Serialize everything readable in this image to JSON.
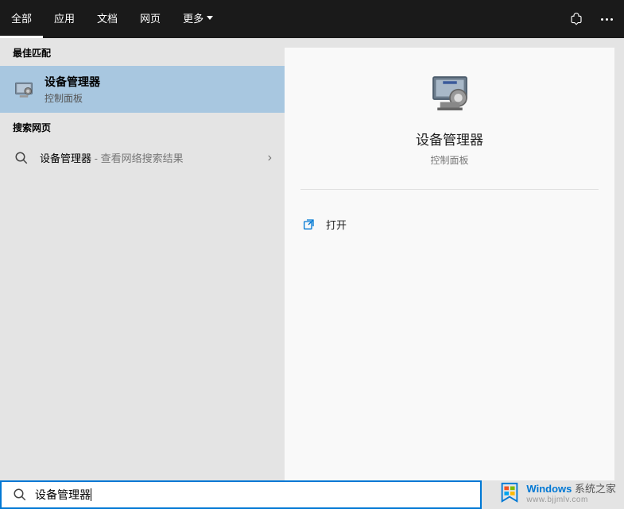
{
  "header": {
    "tabs": [
      {
        "label": "全部",
        "active": true
      },
      {
        "label": "应用",
        "active": false
      },
      {
        "label": "文档",
        "active": false
      },
      {
        "label": "网页",
        "active": false
      },
      {
        "label": "更多",
        "active": false,
        "hasDropdown": true
      }
    ]
  },
  "sections": {
    "bestMatch": "最佳匹配",
    "searchWeb": "搜索网页"
  },
  "bestMatch": {
    "title": "设备管理器",
    "subtitle": "控制面板"
  },
  "webResult": {
    "query": "设备管理器",
    "suffix": " - 查看网络搜索结果"
  },
  "preview": {
    "title": "设备管理器",
    "subtitle": "控制面板",
    "openLabel": "打开"
  },
  "searchInput": {
    "value": "设备管理器"
  },
  "watermark": {
    "brand_prefix": "Windows",
    "brand_suffix": "系统之家",
    "url": "www.bjjmlv.com"
  }
}
